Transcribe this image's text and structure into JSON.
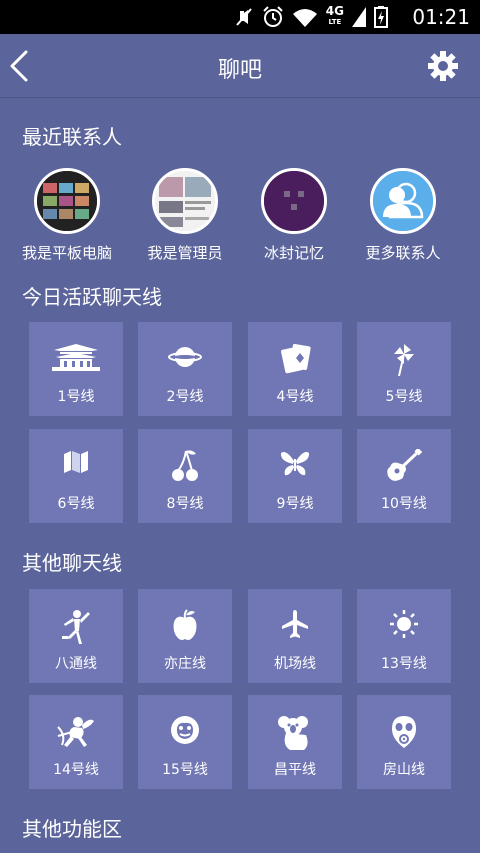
{
  "status_bar": {
    "time": "01:21",
    "network_type": "4G",
    "network_sub": "LTE"
  },
  "header": {
    "title": "聊吧"
  },
  "recent_contacts": {
    "title": "最近联系人",
    "items": [
      {
        "label": "我是平板电脑"
      },
      {
        "label": "我是管理员"
      },
      {
        "label": "冰封记忆"
      },
      {
        "label": "更多联系人"
      }
    ]
  },
  "active_lines": {
    "title": "今日活跃聊天线",
    "items": [
      {
        "label": "1号线",
        "icon": "palace-icon"
      },
      {
        "label": "2号线",
        "icon": "planet-icon"
      },
      {
        "label": "4号线",
        "icon": "playing-cards-icon"
      },
      {
        "label": "5号线",
        "icon": "pinwheel-icon"
      },
      {
        "label": "6号线",
        "icon": "map-icon"
      },
      {
        "label": "8号线",
        "icon": "cherries-icon"
      },
      {
        "label": "9号线",
        "icon": "butterfly-icon"
      },
      {
        "label": "10号线",
        "icon": "guitar-icon"
      }
    ]
  },
  "other_lines": {
    "title": "其他聊天线",
    "items": [
      {
        "label": "八通线",
        "icon": "dancer-icon"
      },
      {
        "label": "亦庄线",
        "icon": "apple-icon"
      },
      {
        "label": "机场线",
        "icon": "airplane-icon"
      },
      {
        "label": "13号线",
        "icon": "sun-icon"
      },
      {
        "label": "14号线",
        "icon": "cupid-icon"
      },
      {
        "label": "15号线",
        "icon": "monkey-icon"
      },
      {
        "label": "昌平线",
        "icon": "koala-icon"
      },
      {
        "label": "房山线",
        "icon": "gas-mask-icon"
      }
    ]
  },
  "other_features": {
    "title": "其他功能区"
  },
  "colors": {
    "background": "#5b649b",
    "tile": "#7177b4",
    "status_bar": "#000000"
  }
}
